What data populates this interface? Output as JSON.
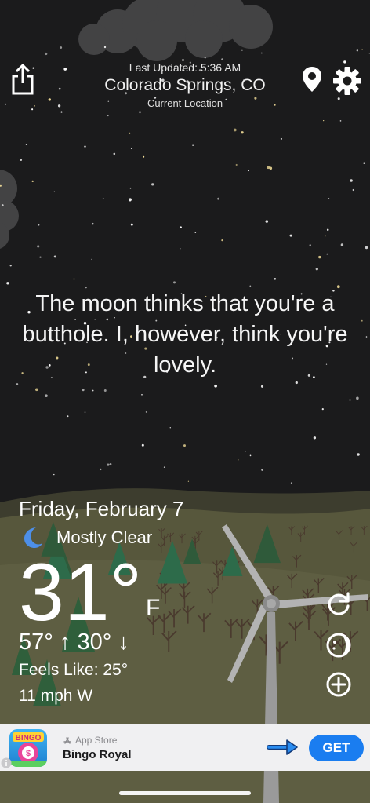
{
  "header": {
    "last_updated": "Last Updated: 5:36 AM",
    "location": "Colorado Springs, CO",
    "location_sub": "Current Location",
    "share_icon": "share-icon",
    "pin_icon": "location-pin-icon",
    "settings_icon": "gear-icon"
  },
  "quote": "The moon thinks that you're a butthole. I, however, think you're lovely.",
  "weather": {
    "date": "Friday, February 7",
    "condition": "Mostly Clear",
    "condition_icon": "moon-icon",
    "temp": "31°",
    "unit": "F",
    "hi": "57°",
    "lo": "30°",
    "feels_like": "Feels Like: 25°",
    "wind": "11 mph W"
  },
  "side_buttons": {
    "refresh_icon": "refresh-icon",
    "moon_phase_icon": "moon-phase-icon",
    "add_icon": "add-location-icon"
  },
  "ad": {
    "store": "App Store",
    "title": "Bingo Royal",
    "cta": "GET",
    "icon_text": "BINGO"
  },
  "colors": {
    "sky": "#1b1b1c",
    "accent": "#1a7df0",
    "ground": "#5e5e42"
  }
}
